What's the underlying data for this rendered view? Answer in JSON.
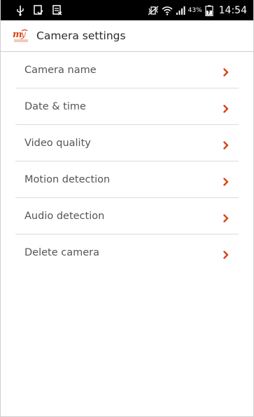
{
  "status_bar": {
    "left_icons": [
      "usb-icon",
      "clipboard-check-icon",
      "spreadsheet-icon"
    ],
    "right_icons": [
      "vibrate-off-icon",
      "wifi-icon",
      "signal-icon",
      "battery-charging-icon"
    ],
    "battery_percent": "43%",
    "time": "14:54"
  },
  "header": {
    "logo_icon": "app-logo-icon",
    "title": "Camera settings"
  },
  "settings": {
    "items": [
      {
        "label": "Camera name"
      },
      {
        "label": "Date & time"
      },
      {
        "label": "Video quality"
      },
      {
        "label": "Motion detection"
      },
      {
        "label": "Audio detection"
      },
      {
        "label": "Delete camera"
      }
    ],
    "chevron_icon": "chevron-right-icon"
  },
  "colors": {
    "accent": "#d84315",
    "status_bar_bg": "#000000",
    "text_primary": "#2b2b2b",
    "text_secondary": "#555555",
    "divider": "#dcdcdc"
  }
}
